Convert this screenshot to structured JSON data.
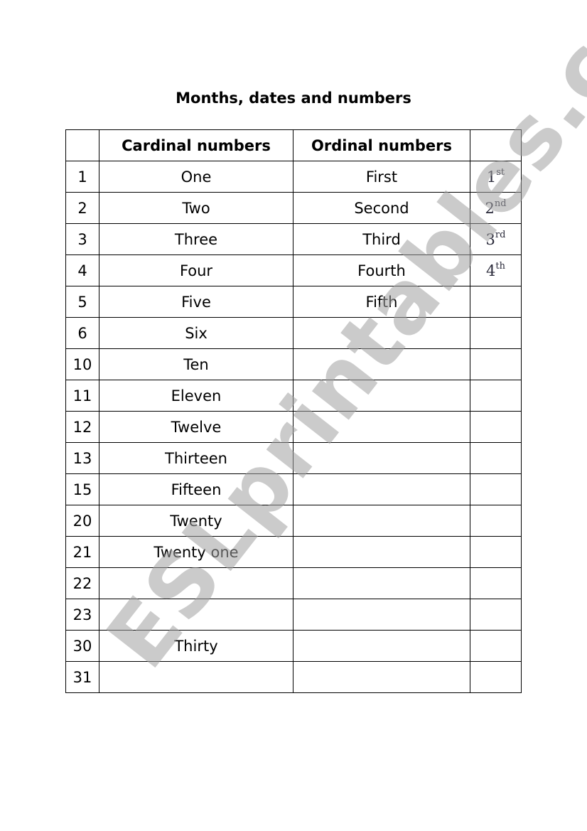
{
  "title": "Months, dates and numbers",
  "headers": [
    "",
    "Cardinal numbers",
    "Ordinal numbers",
    ""
  ],
  "rows": [
    {
      "num": "1",
      "cardinal": "One",
      "ordinal": "First",
      "abbr_num": "1",
      "abbr_suffix": "st"
    },
    {
      "num": "2",
      "cardinal": "Two",
      "ordinal": "Second",
      "abbr_num": "2",
      "abbr_suffix": "nd"
    },
    {
      "num": "3",
      "cardinal": "Three",
      "ordinal": "Third",
      "abbr_num": "3",
      "abbr_suffix": "rd"
    },
    {
      "num": "4",
      "cardinal": "Four",
      "ordinal": "Fourth",
      "abbr_num": "4",
      "abbr_suffix": "th"
    },
    {
      "num": "5",
      "cardinal": "Five",
      "ordinal": "Fifth",
      "abbr_num": "",
      "abbr_suffix": ""
    },
    {
      "num": "6",
      "cardinal": "Six",
      "ordinal": "",
      "abbr_num": "",
      "abbr_suffix": ""
    },
    {
      "num": "10",
      "cardinal": "Ten",
      "ordinal": "",
      "abbr_num": "",
      "abbr_suffix": ""
    },
    {
      "num": "11",
      "cardinal": "Eleven",
      "ordinal": "",
      "abbr_num": "",
      "abbr_suffix": ""
    },
    {
      "num": "12",
      "cardinal": "Twelve",
      "ordinal": "",
      "abbr_num": "",
      "abbr_suffix": ""
    },
    {
      "num": "13",
      "cardinal": "Thirteen",
      "ordinal": "",
      "abbr_num": "",
      "abbr_suffix": ""
    },
    {
      "num": "15",
      "cardinal": "Fifteen",
      "ordinal": "",
      "abbr_num": "",
      "abbr_suffix": ""
    },
    {
      "num": "20",
      "cardinal": "Twenty",
      "ordinal": "",
      "abbr_num": "",
      "abbr_suffix": ""
    },
    {
      "num": "21",
      "cardinal": "Twenty one",
      "ordinal": "",
      "abbr_num": "",
      "abbr_suffix": ""
    },
    {
      "num": "22",
      "cardinal": "",
      "ordinal": "",
      "abbr_num": "",
      "abbr_suffix": ""
    },
    {
      "num": "23",
      "cardinal": "",
      "ordinal": "",
      "abbr_num": "",
      "abbr_suffix": ""
    },
    {
      "num": "30",
      "cardinal": "Thirty",
      "ordinal": "",
      "abbr_num": "",
      "abbr_suffix": ""
    },
    {
      "num": "31",
      "cardinal": "",
      "ordinal": "",
      "abbr_num": "",
      "abbr_suffix": ""
    }
  ],
  "watermark": "ESLprintables.com"
}
